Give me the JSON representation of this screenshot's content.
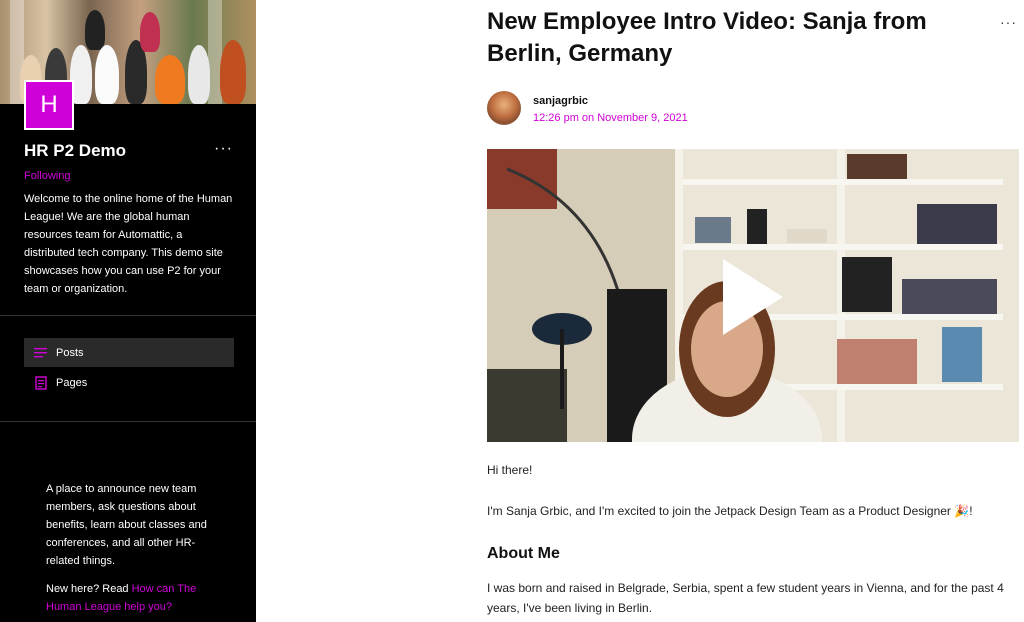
{
  "sidebar": {
    "logo_letter": "H",
    "site_title": "HR P2 Demo",
    "menu_glyph": "···",
    "following": "Following",
    "description": "Welcome to the online home of the Human League! We are the global human resources team for Automattic, a distributed tech company. This demo site showcases how you can use P2 for your team or organization.",
    "nav": [
      {
        "label": "Posts",
        "icon": "list-icon",
        "active": true
      },
      {
        "label": "Pages",
        "icon": "page-icon",
        "active": false
      }
    ],
    "about": "A place to announce new team members, ask questions about benefits, learn about classes and conferences, and all other HR-related things.",
    "new_here_prefix": "New here? Read ",
    "new_here_link": "How can The Human League help you?"
  },
  "post": {
    "title": "New Employee Intro Video: Sanja from Berlin, Germany",
    "menu_glyph": "···",
    "author": "sanjagrbic",
    "date": "12:26 pm on November 9, 2021",
    "greeting": "Hi there!",
    "intro": "I'm Sanja Grbic, and I'm excited to join the Jetpack Design Team as a Product Designer 🎉!",
    "section_heading": "About Me",
    "about_para": "I was born and raised in Belgrade, Serbia, spent a few student years in Vienna, and for the past 4 years, I've been living in Berlin."
  },
  "colors": {
    "accent": "#d000d8",
    "sidebar_bg": "#000000"
  }
}
